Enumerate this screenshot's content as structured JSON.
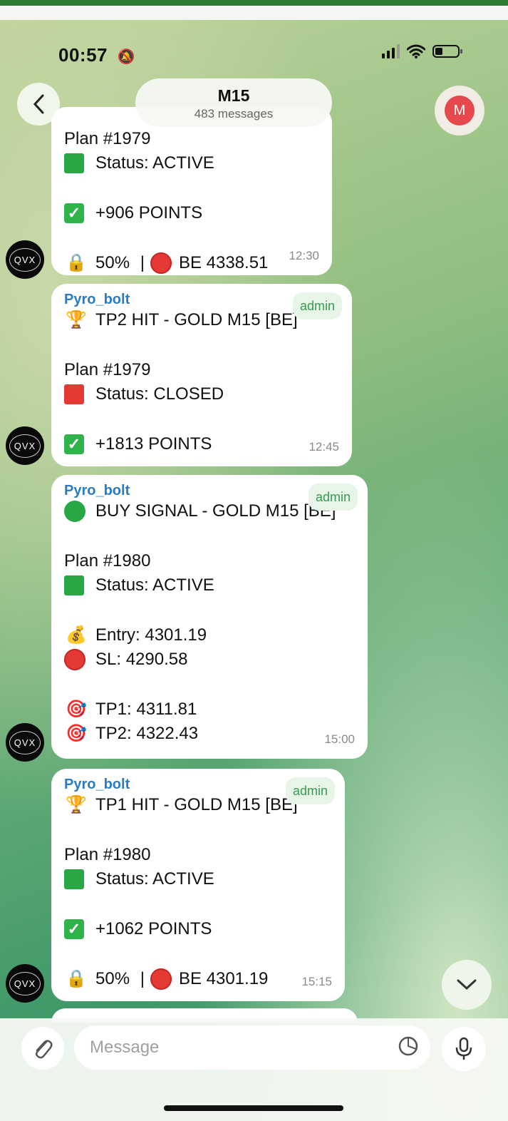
{
  "status_bar": {
    "time": "00:57",
    "bell_icon": "bell-slash-icon"
  },
  "header": {
    "back_icon": "chevron-left-icon",
    "title": "M15",
    "subtitle": "483 messages",
    "avatar_letter": "M"
  },
  "messages": [
    {
      "sender_partial": "Plan #1979",
      "plan": "Plan #1979",
      "status": "Status: ACTIVE",
      "points": "+906 POINTS",
      "lock_line": {
        "percent": "50%",
        "sep": "|",
        "be": "BE 4338.51"
      },
      "time": "12:30",
      "avatar": "QVX"
    },
    {
      "sender": "Pyro_bolt",
      "badge": "admin",
      "headline": "TP2 HIT - GOLD M15 [BE]",
      "plan": "Plan #1979",
      "status": "Status: CLOSED",
      "points": "+1813 POINTS",
      "time": "12:45",
      "avatar": "QVX"
    },
    {
      "sender": "Pyro_bolt",
      "badge": "admin",
      "headline": "BUY SIGNAL - GOLD M15 [BE]",
      "plan": "Plan #1980",
      "status": "Status: ACTIVE",
      "entry": "Entry: 4301.19",
      "sl": "SL: 4290.58",
      "tp1": "TP1: 4311.81",
      "tp2": "TP2: 4322.43",
      "time": "15:00",
      "avatar": "QVX"
    },
    {
      "sender": "Pyro_bolt",
      "badge": "admin",
      "headline": "TP1 HIT - GOLD M15 [BE]",
      "plan": "Plan #1980",
      "status": "Status: ACTIVE",
      "points": "+1062 POINTS",
      "lock_line": {
        "percent": "50%",
        "sep": "|",
        "be": "BE 4301.19"
      },
      "time": "15:15",
      "avatar": "QVX"
    }
  ],
  "composer": {
    "placeholder": "Message"
  }
}
